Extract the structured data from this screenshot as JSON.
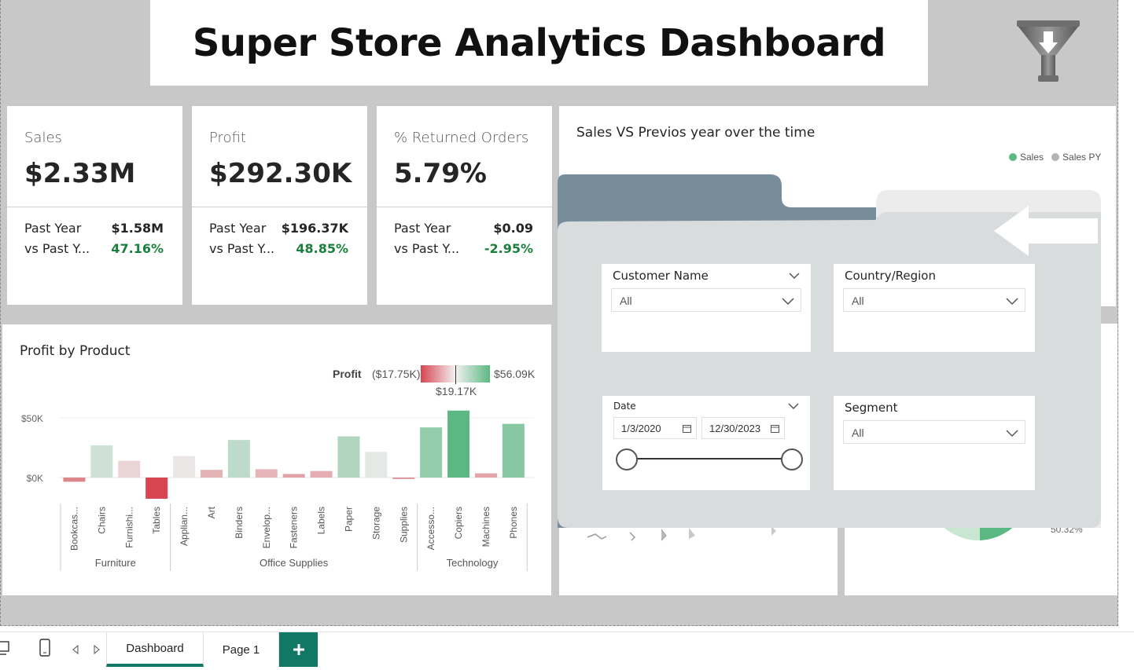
{
  "header": {
    "title": "Super Store Analytics Dashboard"
  },
  "icons": {
    "filter": "funnel-download-icon",
    "back": "arrow-left-icon"
  },
  "kpis": [
    {
      "label": "Sales",
      "value": "$2.33M",
      "py_label": "Past Year",
      "py_value": "$1.58M",
      "vs_label": "vs Past Y...",
      "vs_value": "47.16%"
    },
    {
      "label": "Profit",
      "value": "$292.30K",
      "py_label": "Past Year",
      "py_value": "$196.37K",
      "vs_label": "vs Past Y...",
      "vs_value": "48.85%"
    },
    {
      "label": "% Returned Orders",
      "value": "5.79%",
      "py_label": "Past Year",
      "py_value": "$0.09",
      "vs_label": "vs Past Y...",
      "vs_value": "-2.95%"
    }
  ],
  "sales_chart": {
    "title": "Sales VS Previos year over the time",
    "legend": [
      "Sales",
      "Sales PY"
    ],
    "legend_colors": [
      "#5cb883",
      "#b3b3b3"
    ]
  },
  "profit_chart": {
    "title": "Profit by Product",
    "legend_label": "Profit",
    "legend_min": "($17.75K)",
    "legend_max": "$56.09K",
    "legend_mid": "$19.17K"
  },
  "chart_data": {
    "type": "bar",
    "title": "Profit by Product",
    "categories": [
      "Bookcas...",
      "Chairs",
      "Furnishi...",
      "Tables",
      "Applian...",
      "Art",
      "Binders",
      "Envelop...",
      "Fasteners",
      "Labels",
      "Paper",
      "Storage",
      "Supplies",
      "Accesso...",
      "Copiers",
      "Machines",
      "Phones"
    ],
    "groups": [
      {
        "name": "Furniture",
        "count": 4
      },
      {
        "name": "Office Supplies",
        "count": 9
      },
      {
        "name": "Technology",
        "count": 4
      }
    ],
    "values": [
      -3.5,
      27,
      14,
      -17.75,
      18,
      6.5,
      31.5,
      7,
      3,
      5.5,
      34.5,
      21.5,
      -1.2,
      42,
      56.09,
      3.5,
      45
    ],
    "y_ticks": [
      "$0K",
      "$50K"
    ],
    "ylim": [
      -17.75,
      56.09
    ],
    "color_scale": {
      "min": -17.75,
      "mid": 19.17,
      "max": 56.09,
      "low": "#d64550",
      "mid_color": "#ececec",
      "high": "#5cb883"
    }
  },
  "filters": {
    "customer": {
      "label": "Customer Name",
      "value": "All"
    },
    "country": {
      "label": "Country/Region",
      "value": "All"
    },
    "date": {
      "label": "Date",
      "start": "1/3/2020",
      "end": "12/30/2023"
    },
    "segment": {
      "label": "Segment",
      "value": "All"
    }
  },
  "background_peek": {
    "pie_label": "50.32%"
  },
  "tabs": [
    {
      "label": "Dashboard",
      "active": true
    },
    {
      "label": "Page 1",
      "active": false
    }
  ]
}
